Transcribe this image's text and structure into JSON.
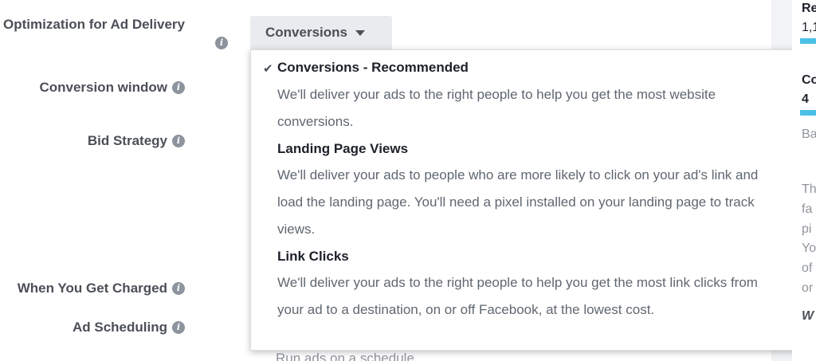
{
  "form": {
    "optimization_label": "Optimization for Ad Delivery",
    "conversion_window_label": "Conversion window",
    "bid_strategy_label": "Bid Strategy",
    "when_charged_label": "When You Get Charged",
    "ad_scheduling_label": "Ad Scheduling",
    "info_glyph": "i",
    "ad_scheduling_hint": "Run ads on a schedule"
  },
  "dropdown": {
    "selected": "Conversions",
    "check_glyph": "✔",
    "options": [
      {
        "title": "Conversions - Recommended",
        "description": "We'll deliver your ads to the right people to help you get the most website conversions.",
        "selected": true
      },
      {
        "title": "Landing Page Views",
        "description": "We'll deliver your ads to people who are more likely to click on your ad's link and load the landing page. You'll need a pixel installed on your landing page to track views.",
        "selected": false
      },
      {
        "title": "Link Clicks",
        "description": "We'll deliver your ads to the right people to help you get the most link clicks from your ad to a destination, on or off Facebook, at the lowest cost.",
        "selected": false
      }
    ]
  },
  "side": {
    "line1": "Re",
    "line2": "1,1",
    "line3": "Co",
    "line4": "4",
    "line5": "Ba",
    "line6": "Th",
    "line7": "fa",
    "line8": "pi",
    "line9": "Yo",
    "line10": "of",
    "line11": "or",
    "line12": "W"
  },
  "colors": {
    "accent": "#4bc0e6",
    "label_text": "#4b4f56",
    "title_text": "#1d2129",
    "desc_text": "#606770",
    "dropdown_bg": "#e9ebee"
  }
}
